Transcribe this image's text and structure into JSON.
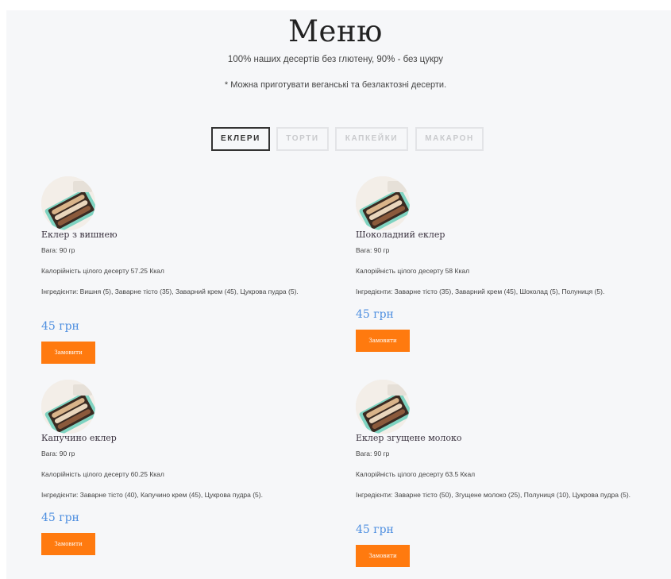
{
  "header": {
    "title": "Меню",
    "subtitle": "100% наших десертів без глютену, 90% - без цукру",
    "note": "* Можна приготувати веганські та безлактозні десерти."
  },
  "tabs": [
    {
      "label": "ЕКЛЕРИ",
      "active": true
    },
    {
      "label": "ТОРТИ",
      "active": false
    },
    {
      "label": "КАПКЕЙКИ",
      "active": false
    },
    {
      "label": "МАКАРОН",
      "active": false
    }
  ],
  "products": [
    {
      "name": "Еклер з вишнею",
      "weight": "Вага: 90 гр",
      "calories": "Калорійність цілого десерту 57.25 Ккал",
      "ingredients": "Інгредієнти: Вишня (5), Заварне тісто (35), Заварний крем (45), Цукрова пудра (5).",
      "price": "45 грн",
      "order_label": "Замовити"
    },
    {
      "name": "Шоколадний еклер",
      "weight": "Вага: 90 гр",
      "calories": "Калорійність цілого десерту 58 Ккал",
      "ingredients": "Інгредієнти: Заварне тісто (35), Заварний крем (45), Шоколад (5), Полуниця (5).",
      "price": "45 грн",
      "order_label": "Замовити"
    },
    {
      "name": "Капучино еклер",
      "weight": "Вага: 90 гр",
      "calories": "Калорійність цілого десерту 60.25 Ккал",
      "ingredients": "Інгредієнти: Заварне тісто (40), Капучино крем (45), Цукрова пудра (5).",
      "price": "45 грн",
      "order_label": "Замовити"
    },
    {
      "name": "Еклер згущене молоко",
      "weight": "Вага: 90 гр",
      "calories": "Калорійність цілого десерту 63.5 Ккал",
      "ingredients": "Інгредієнти: Заварне тісто (50), Згущене молоко (25), Полуниця (10), Цукрова пудра (5).",
      "price": "45 грн",
      "order_label": "Замовити"
    }
  ],
  "colors": {
    "accent_orange": "#ff7a0f",
    "price_blue": "#4e8fe0",
    "panel_bg": "#f6f7f9"
  },
  "icons": {
    "product_image": "eclair-box-photo"
  }
}
